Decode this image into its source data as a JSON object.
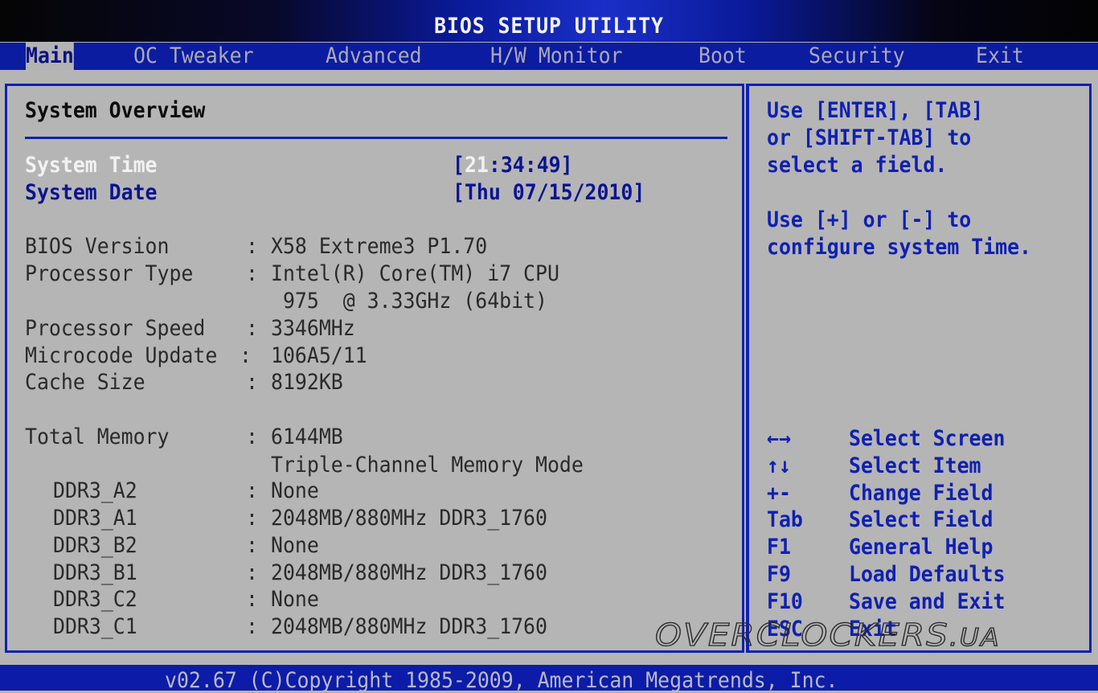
{
  "header": {
    "title": "BIOS SETUP UTILITY"
  },
  "menu": {
    "tabs": [
      {
        "label": "Main",
        "active": true
      },
      {
        "label": "OC Tweaker",
        "active": false
      },
      {
        "label": "Advanced",
        "active": false
      },
      {
        "label": "H/W Monitor",
        "active": false
      },
      {
        "label": "Boot",
        "active": false
      },
      {
        "label": "Security",
        "active": false
      },
      {
        "label": "Exit",
        "active": false
      }
    ]
  },
  "main": {
    "section_title": "System Overview",
    "fields": [
      {
        "label": "System Time",
        "value_prefix": "[",
        "value_highlight": "21",
        "value_rest": ":34:49]",
        "selected": true
      },
      {
        "label": "System Date",
        "value": "[Thu 07/15/2010]",
        "selected": false
      }
    ],
    "info": [
      {
        "label": "BIOS Version",
        "sep": ":",
        "value": "X58 Extreme3 P1.70"
      },
      {
        "label": "Processor Type",
        "sep": ":",
        "value": "Intel(R) Core(TM) i7 CPU"
      },
      {
        "label": "",
        "sep": "",
        "value": " 975  @ 3.33GHz (64bit)"
      },
      {
        "label": "Processor Speed",
        "sep": ":",
        "value": "3346MHz"
      },
      {
        "label": "Microcode Update",
        "sep": ":",
        "value": "106A5/11"
      },
      {
        "label": "Cache Size",
        "sep": ":",
        "value": "8192KB"
      }
    ],
    "memory": {
      "total_label": "Total Memory",
      "total_value": "6144MB",
      "mode": "Triple-Channel Memory Mode",
      "slots": [
        {
          "label": "DDR3_A2",
          "value": "None"
        },
        {
          "label": "DDR3_A1",
          "value": "2048MB/880MHz DDR3_1760"
        },
        {
          "label": "DDR3_B2",
          "value": "None"
        },
        {
          "label": "DDR3_B1",
          "value": "2048MB/880MHz DDR3_1760"
        },
        {
          "label": "DDR3_C2",
          "value": "None"
        },
        {
          "label": "DDR3_C1",
          "value": "2048MB/880MHz DDR3_1760"
        }
      ]
    }
  },
  "help": {
    "lines": [
      "Use [ENTER], [TAB]",
      "or [SHIFT-TAB] to",
      "select a field.",
      "",
      "Use [+] or [-] to",
      "configure system Time."
    ],
    "keys": [
      {
        "key": "←→",
        "icon": "left-right-arrows-icon",
        "desc": "Select Screen"
      },
      {
        "key": "↑↓",
        "icon": "up-down-arrows-icon",
        "desc": "Select Item"
      },
      {
        "key": "+-",
        "icon": "plus-minus-icon",
        "desc": "Change Field"
      },
      {
        "key": "Tab",
        "desc": "Select Field"
      },
      {
        "key": "F1",
        "desc": "General Help"
      },
      {
        "key": "F9",
        "desc": "Load Defaults"
      },
      {
        "key": "F10",
        "desc": "Save and Exit"
      },
      {
        "key": "ESC",
        "desc": "Exit"
      }
    ]
  },
  "footer": {
    "text": "v02.67 (C)Copyright 1985-2009, American Megatrends, Inc."
  },
  "watermark": {
    "text": "OVERCLOCKERS",
    "suffix": ".UA"
  },
  "colors": {
    "menu_blue": "#0c1ca0",
    "panel_border": "#1020b0",
    "background_gray": "#b5b5b5",
    "text_blue": "#1020b0",
    "text_white": "#f2f2f2"
  }
}
